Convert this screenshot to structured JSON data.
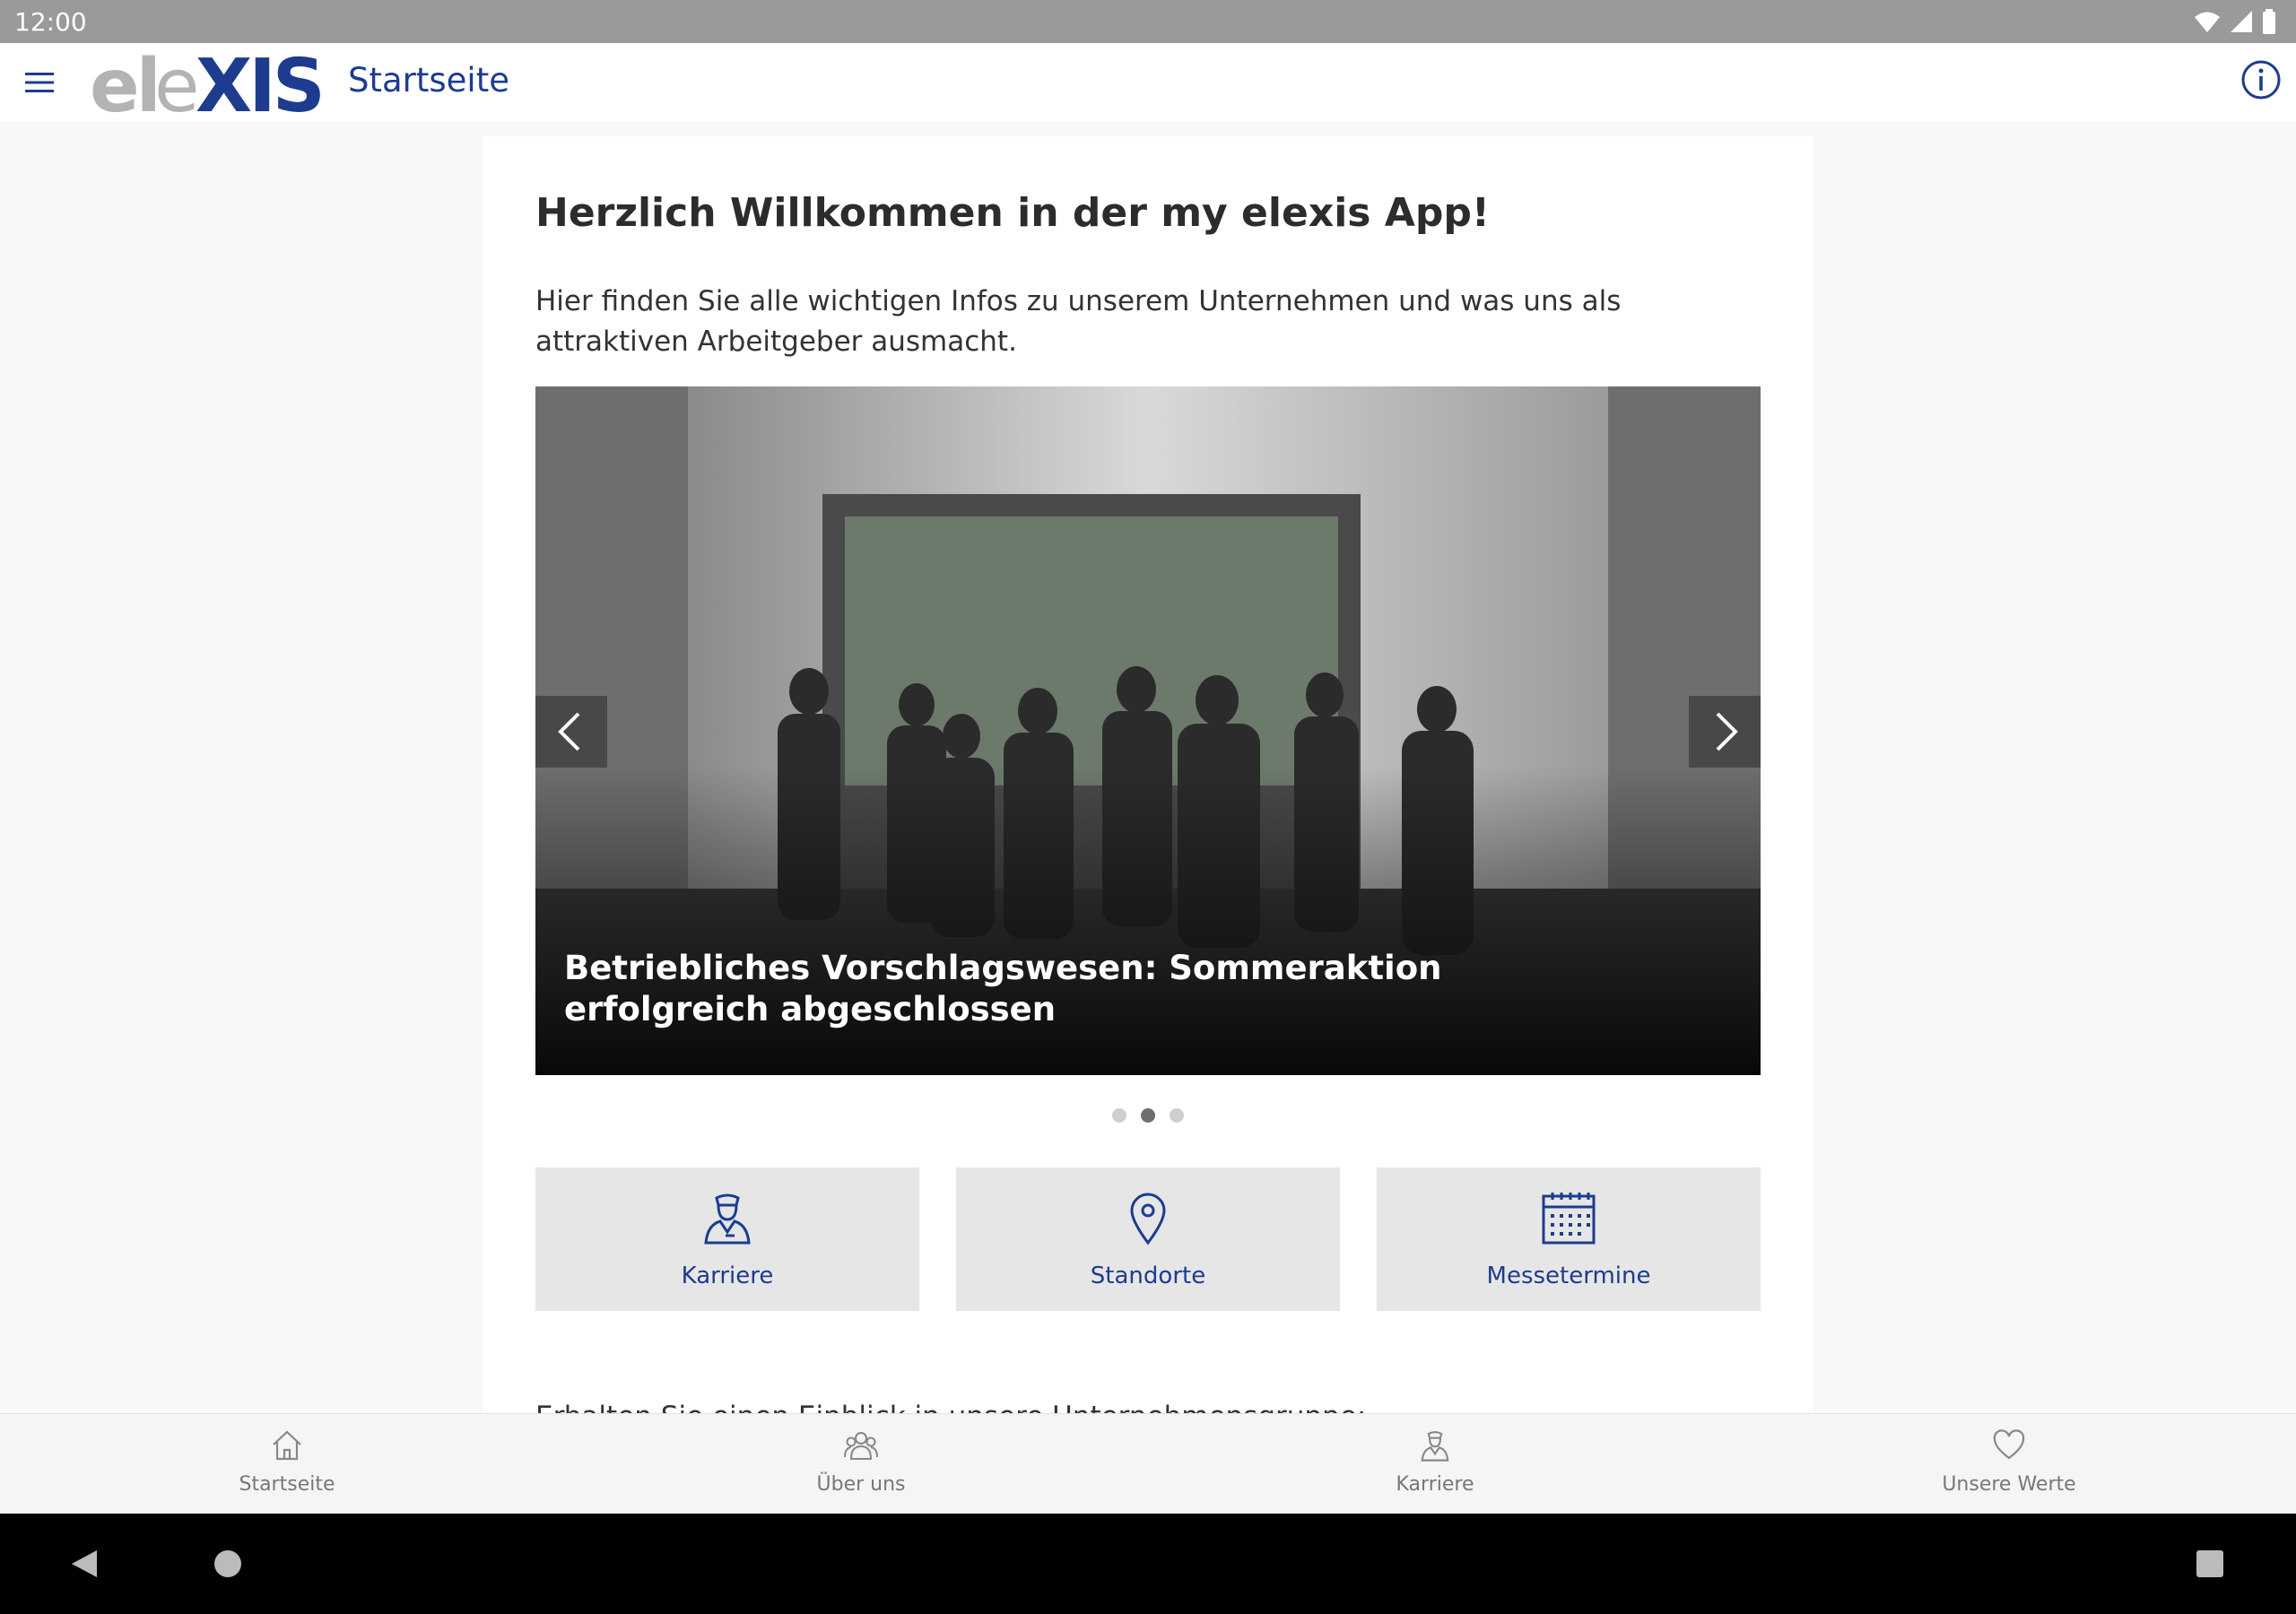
{
  "statusbar": {
    "time": "12:00",
    "icons": [
      "wifi-icon",
      "signal-icon",
      "battery-icon"
    ]
  },
  "appbar": {
    "logo_text": "elexis",
    "title": "Startseite",
    "colors": {
      "brand_blue": "#1d3c8f",
      "logo_gray": "#b3b3b3"
    }
  },
  "main": {
    "heading": "Herzlich Willkommen in der my elexis App!",
    "intro": "Hier finden Sie alle wichtigen Infos zu unserem Unternehmen und was uns als attraktiven Arbeitgeber ausmacht.",
    "carousel": {
      "caption": "Betriebliches Vorschlagswesen: Sommeraktion erfolgreich abgeschlossen",
      "slide_count": 3,
      "active_slide": 2
    },
    "tiles": [
      {
        "label": "Karriere",
        "icon": "worker-icon"
      },
      {
        "label": "Standorte",
        "icon": "location-pin-icon"
      },
      {
        "label": "Messetermine",
        "icon": "calendar-icon"
      }
    ],
    "teaser": "Erhalten Sie einen Einblick in unsere Unternehmensgruppe:"
  },
  "bottomnav": [
    {
      "label": "Startseite",
      "icon": "home-icon"
    },
    {
      "label": "Über uns",
      "icon": "team-icon"
    },
    {
      "label": "Karriere",
      "icon": "worker-icon"
    },
    {
      "label": "Unsere Werte",
      "icon": "heart-icon"
    }
  ]
}
